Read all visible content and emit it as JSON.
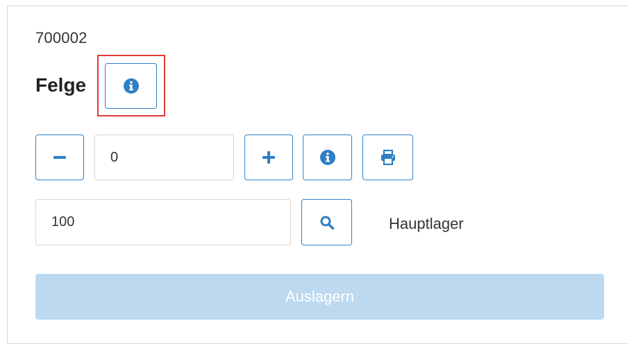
{
  "article": {
    "number": "700002",
    "name": "Felge"
  },
  "quantity": {
    "value": "0",
    "decrement_icon": "minus-icon",
    "increment_icon": "plus-icon",
    "info_icon": "info-icon",
    "print_icon": "print-icon"
  },
  "storage": {
    "location_value": "100",
    "search_icon": "search-icon",
    "location_name": "Hauptlager"
  },
  "actions": {
    "submit_label": "Auslagern"
  },
  "colors": {
    "accent": "#2f7fc6",
    "highlight": "#e03a3a",
    "disabled_button": "#bcd9f0"
  }
}
